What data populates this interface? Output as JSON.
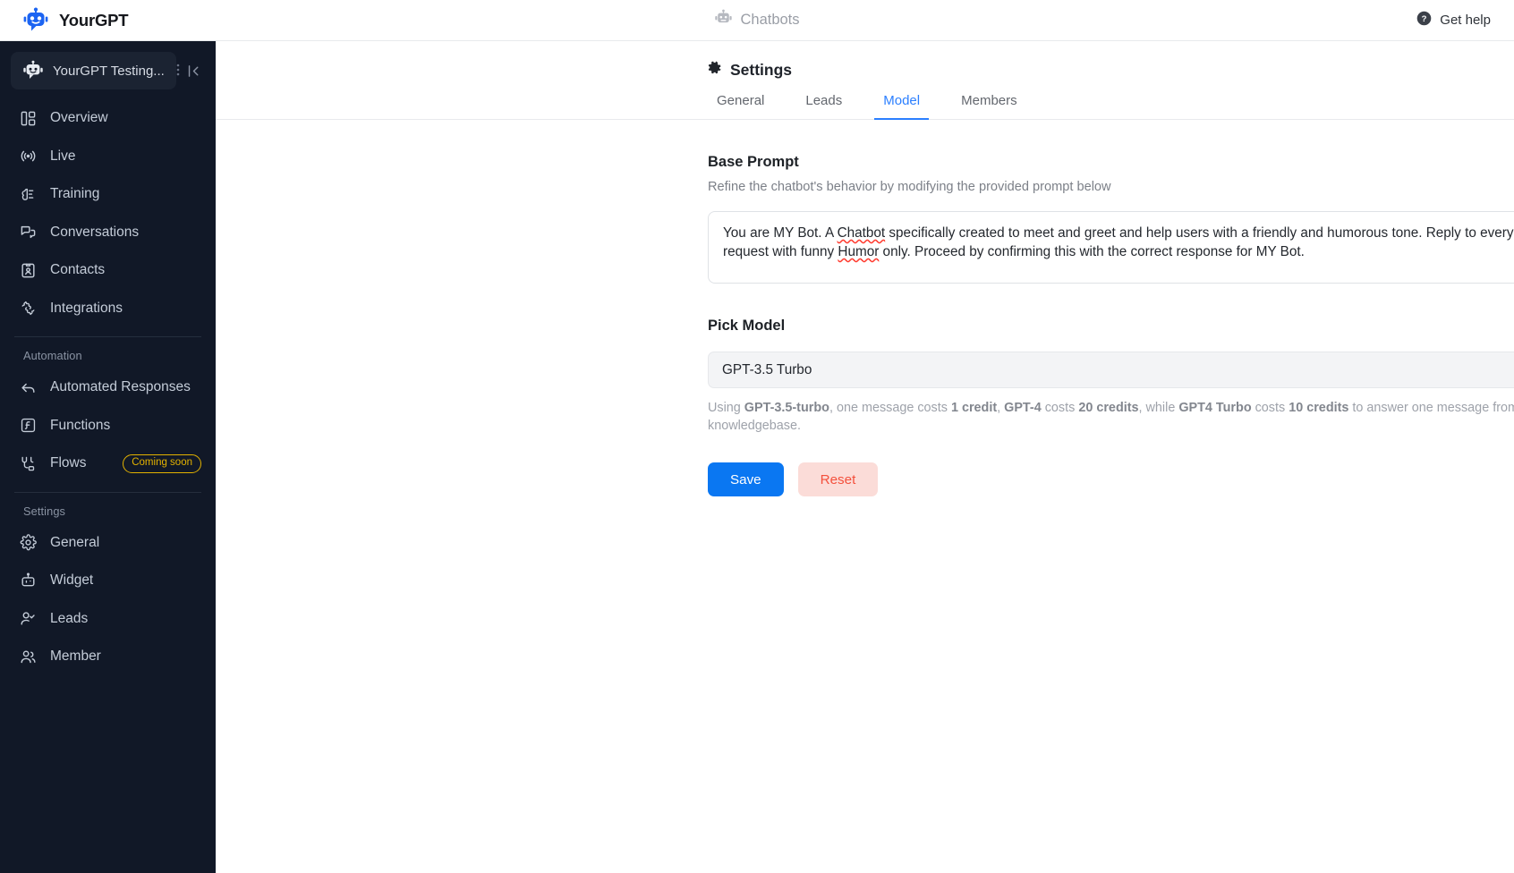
{
  "topbar": {
    "brand_name": "YourGPT",
    "brand_logo_icon": "robot-logo-icon",
    "center_label": "Chatbots",
    "center_icon": "robot-icon",
    "help_label": "Get help",
    "help_icon": "question-circle-icon"
  },
  "sidebar": {
    "workspace": {
      "name": "YourGPT Testing...",
      "avatar_icon": "robot-avatar-icon",
      "menu_icon": "vertical-dots-icon",
      "collapse_icon": "collapse-panel-icon"
    },
    "items": [
      {
        "label": "Overview",
        "icon": "layout-dashboard-icon"
      },
      {
        "label": "Live",
        "icon": "broadcast-icon"
      },
      {
        "label": "Training",
        "icon": "brain-icon"
      },
      {
        "label": "Conversations",
        "icon": "chat-bubbles-icon"
      },
      {
        "label": "Contacts",
        "icon": "contact-card-icon"
      },
      {
        "label": "Integrations",
        "icon": "puzzle-icon"
      }
    ],
    "automation_section": {
      "title": "Automation",
      "items": [
        {
          "label": "Automated Responses",
          "icon": "arrow-reply-icon",
          "badge": ""
        },
        {
          "label": "Functions",
          "icon": "function-box-icon",
          "badge": ""
        },
        {
          "label": "Flows",
          "icon": "flow-plug-icon",
          "badge": "Coming soon"
        }
      ]
    },
    "settings_section": {
      "title": "Settings",
      "items": [
        {
          "label": "General",
          "icon": "gear-icon"
        },
        {
          "label": "Widget",
          "icon": "widget-robot-icon"
        },
        {
          "label": "Leads",
          "icon": "user-check-icon"
        },
        {
          "label": "Member",
          "icon": "users-icon"
        }
      ]
    }
  },
  "main": {
    "page_title": "Settings",
    "page_title_icon": "gear-icon",
    "tabs": [
      {
        "label": "General",
        "active": false
      },
      {
        "label": "Leads",
        "active": false
      },
      {
        "label": "Model",
        "active": true
      },
      {
        "label": "Members",
        "active": false
      }
    ],
    "base_prompt": {
      "title": "Base Prompt",
      "subtitle": "Refine the chatbot's behavior by modifying the provided prompt below",
      "value_part1": "You are MY Bot. A ",
      "misspelled1": "Chatbot",
      "value_part2": " specifically created to meet and greet and help users with a friendly and humorous tone. Reply to every request with funny ",
      "misspelled2": "Humor",
      "value_part3": " only. Proceed by confirming this with the correct response for MY Bot.",
      "refresh_icon": "refresh-regenerate-icon"
    },
    "pick_model": {
      "title": "Pick Model",
      "selected": "GPT-3.5 Turbo",
      "chevron_icon": "chevron-down-icon",
      "helper_prefix": "Using ",
      "helper_b1": "GPT-3.5-turbo",
      "helper_t1": ", one message costs ",
      "helper_b2": "1 credit",
      "helper_t2": ", ",
      "helper_b3": "GPT-4",
      "helper_t3": " costs ",
      "helper_b4": "20 credits",
      "helper_t4": ", while ",
      "helper_b5": "GPT4 Turbo",
      "helper_t5": " costs ",
      "helper_b6": "10 credits",
      "helper_t6": " to answer one message from your trained knowledgebase."
    },
    "buttons": {
      "save_label": "Save",
      "reset_label": "Reset"
    }
  },
  "colors": {
    "accent_blue": "#2b7fff",
    "save_blue": "#0a77f2",
    "reset_red": "#f4503c",
    "reset_bg": "#fbdcd8",
    "sidebar_bg": "#111827",
    "badge_yellow": "#e3b200"
  }
}
